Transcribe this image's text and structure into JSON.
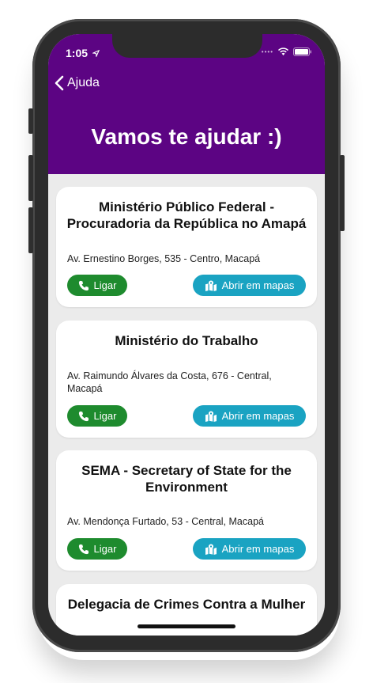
{
  "status": {
    "time": "1:05"
  },
  "nav": {
    "back_label": "Ajuda"
  },
  "header": {
    "title": "Vamos te ajudar :)"
  },
  "cards": [
    {
      "title_lines": [
        "Ministério Público Federal -",
        "Procuradoria da República no Amapá"
      ],
      "address_lines": [
        "Av. Ernestino Borges, 535 - Centro, Macapá"
      ],
      "call_label": "Ligar",
      "map_label": "Abrir em mapas"
    },
    {
      "title_lines": [
        "Ministério do Trabalho"
      ],
      "address_lines": [
        "Av. Raimundo Álvares da Costa, 676 - Central,",
        "Macapá"
      ],
      "call_label": "Ligar",
      "map_label": "Abrir em mapas"
    },
    {
      "title_lines": [
        "SEMA - Secretary of State for the",
        "Environment"
      ],
      "address_lines": [
        "Av. Mendonça Furtado, 53 - Central, Macapá"
      ],
      "call_label": "Ligar",
      "map_label": "Abrir em mapas"
    },
    {
      "title_lines": [
        "Delegacia de Crimes Contra a Mulher"
      ]
    }
  ],
  "colors": {
    "header": "#5c0483",
    "call_button": "#1e8b2e",
    "map_button": "#1aa3c2",
    "background": "#ebebeb"
  },
  "icons": {
    "back": "chevron-left-icon",
    "call": "phone-icon",
    "map": "map-marked-icon"
  }
}
